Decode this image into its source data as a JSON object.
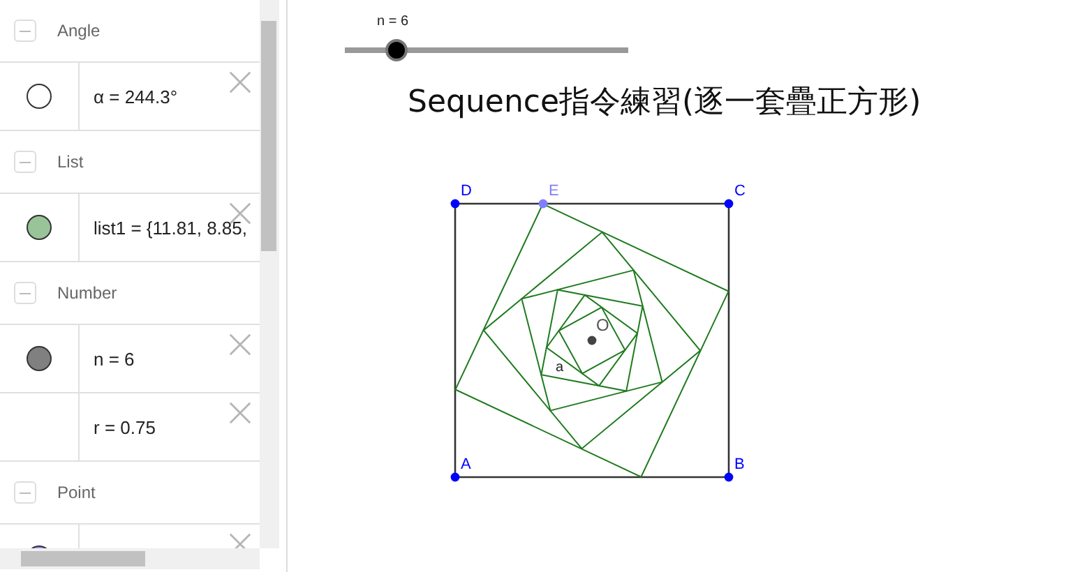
{
  "algebra": {
    "groups": [
      {
        "label": "Angle",
        "expanded": true,
        "items": [
          {
            "kind": "dot",
            "color": "#ffffff",
            "text": "α = 244.3°"
          }
        ]
      },
      {
        "label": "List",
        "expanded": true,
        "items": [
          {
            "kind": "dot",
            "color": "#99c499",
            "text": "list1 = {11.81, 8.85,"
          }
        ]
      },
      {
        "label": "Number",
        "expanded": true,
        "items": [
          {
            "kind": "dot",
            "color": "#808080",
            "text": "n = 6"
          },
          {
            "kind": "none",
            "text": "r = 0.75"
          }
        ]
      },
      {
        "label": "Point",
        "expanded": true,
        "items": [
          {
            "kind": "dot",
            "color": "#9999ff"
          }
        ]
      }
    ]
  },
  "slider": {
    "label": "n = 6",
    "level": 0.17
  },
  "title": "Sequence指令練習(逐一套疊正方形)",
  "figure": {
    "points": [
      {
        "label": "D",
        "color": "#0000ff"
      },
      {
        "label": "E",
        "color": "#7f7fff"
      },
      {
        "label": "C",
        "color": "#0000ff"
      },
      {
        "label": "A",
        "color": "#0000ff"
      },
      {
        "label": "B",
        "color": "#0000ff"
      }
    ],
    "center": "O",
    "segment": "a"
  }
}
